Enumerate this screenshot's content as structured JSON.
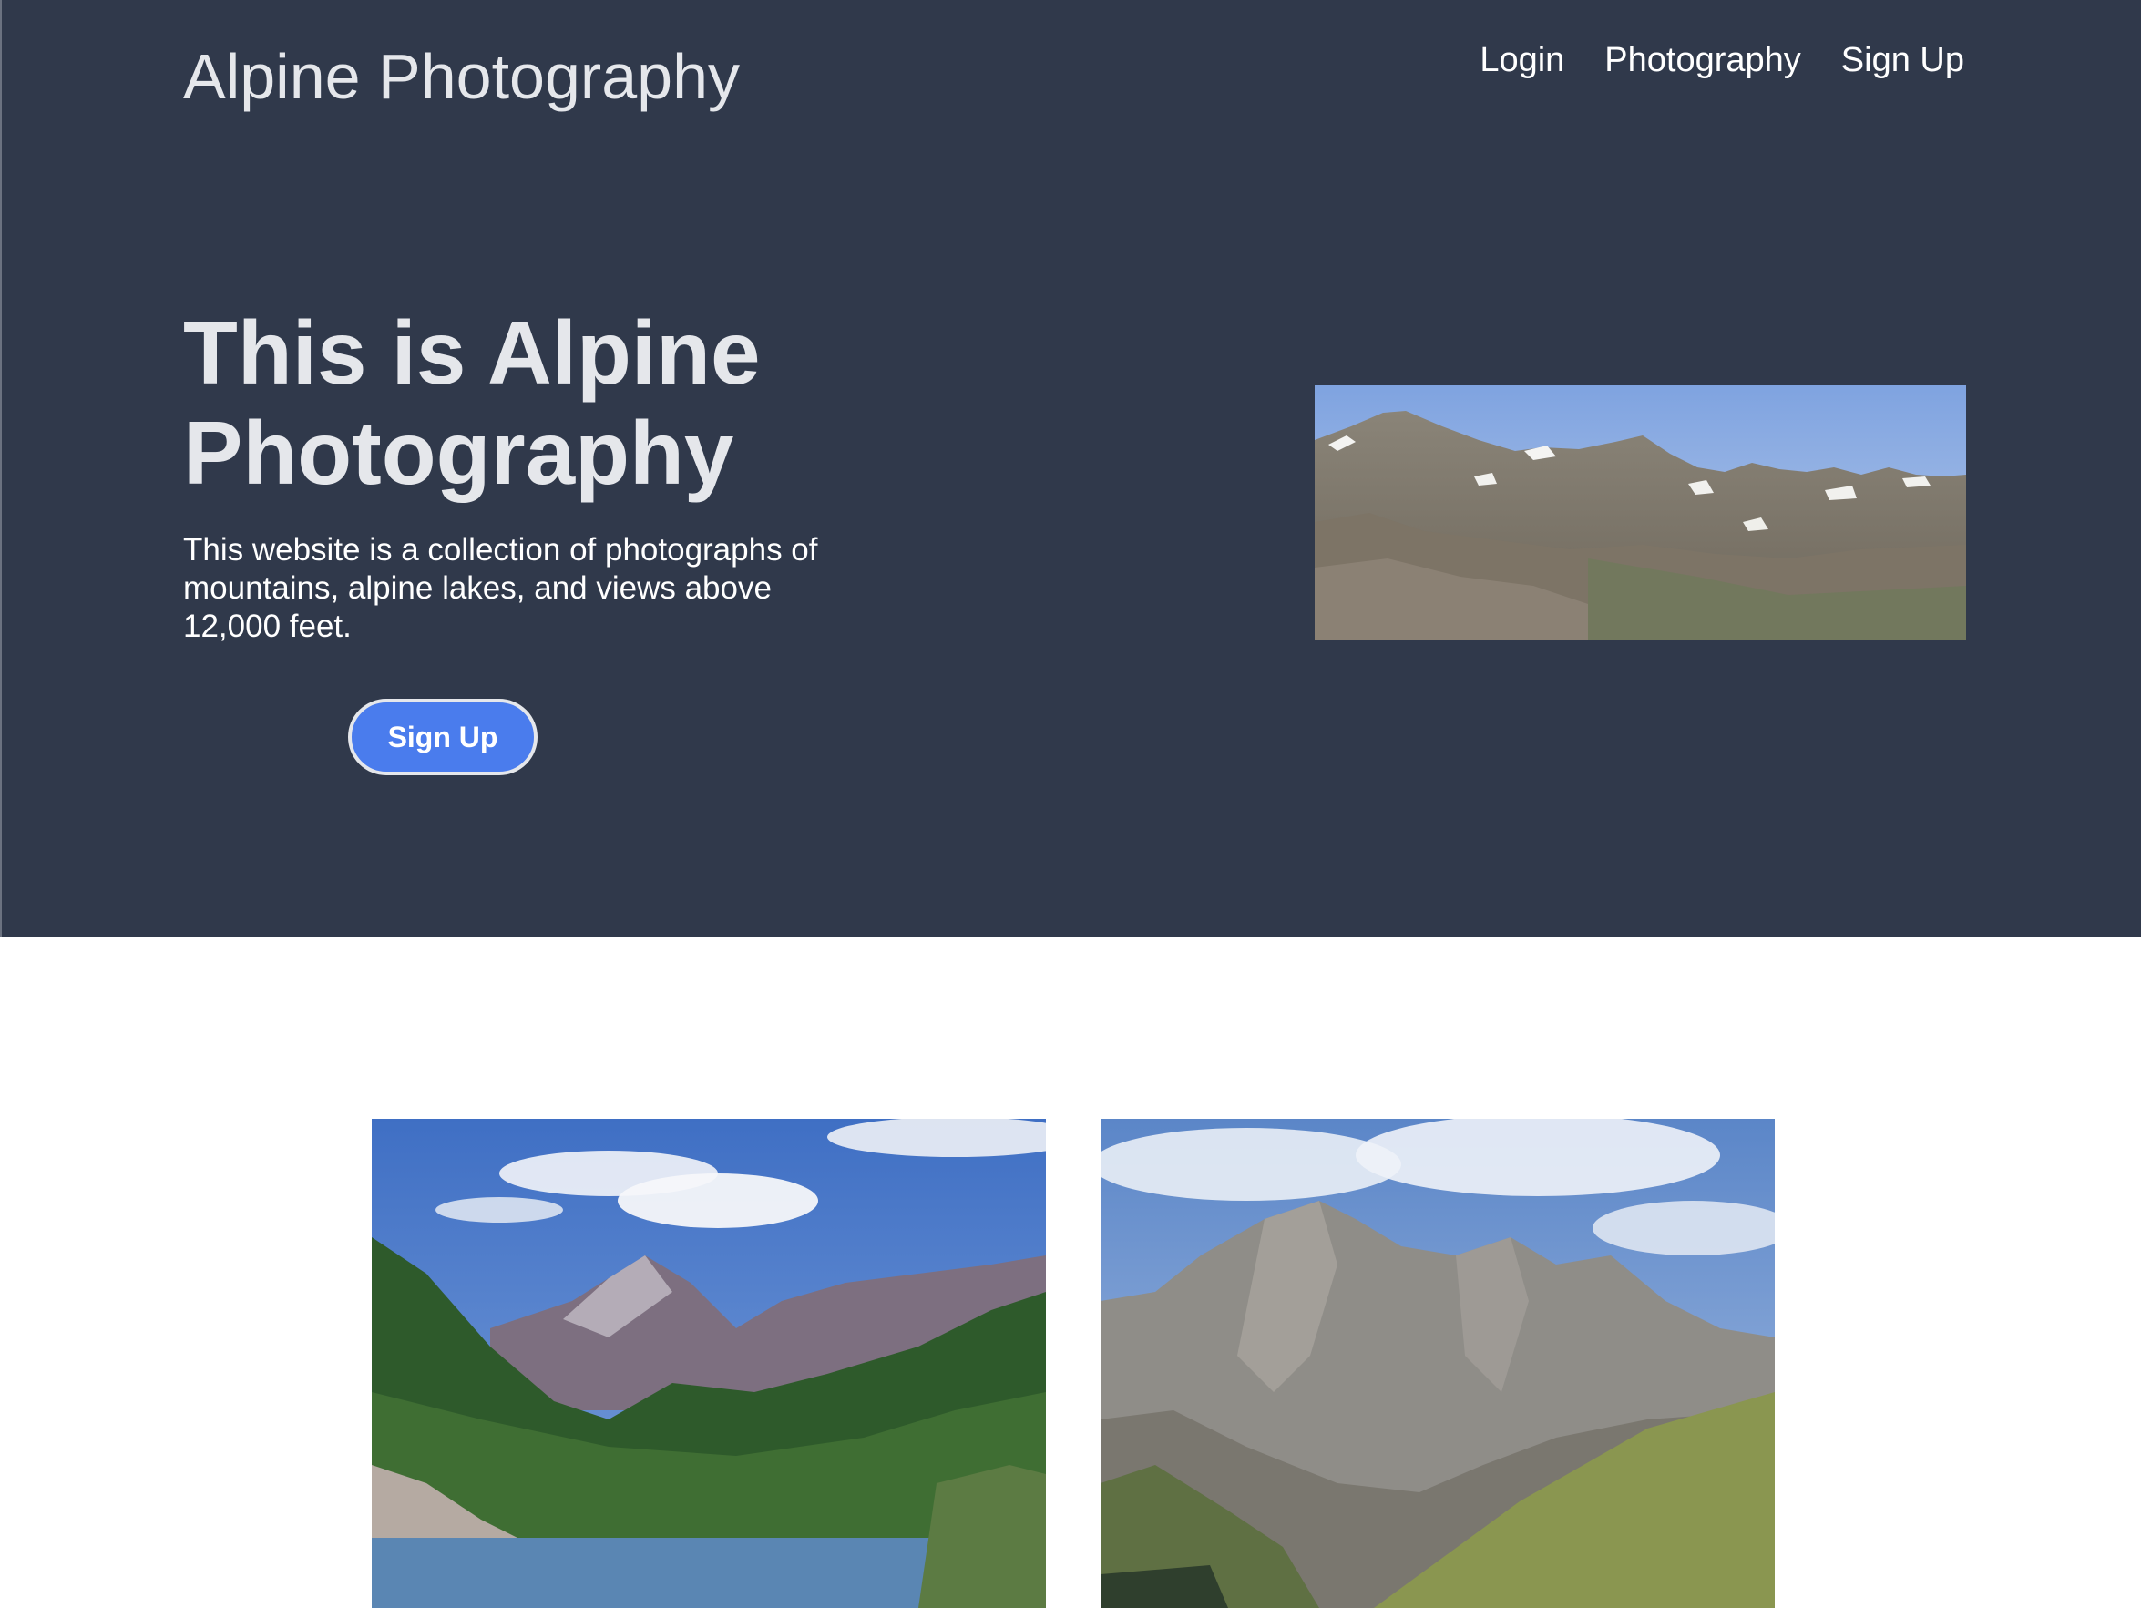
{
  "header": {
    "brand": "Alpine Photography",
    "nav": [
      {
        "label": "Login"
      },
      {
        "label": "Photography"
      },
      {
        "label": "Sign Up"
      }
    ]
  },
  "hero": {
    "title": "This is Alpine Photography",
    "description": "This website is a collection of photographs of mountains, alpine lakes, and views above 12,000 feet.",
    "cta_label": "Sign Up",
    "image_label": "panoramic-ridge-photo"
  },
  "gallery": {
    "images": [
      {
        "name": "lake-valley-peaks-photo"
      },
      {
        "name": "rocky-peak-meadow-photo"
      }
    ]
  },
  "colors": {
    "header_bg": "#30394b",
    "heading_text": "#e5e7eb",
    "button_bg": "#4a7ced",
    "page_bg": "#ffffff"
  }
}
